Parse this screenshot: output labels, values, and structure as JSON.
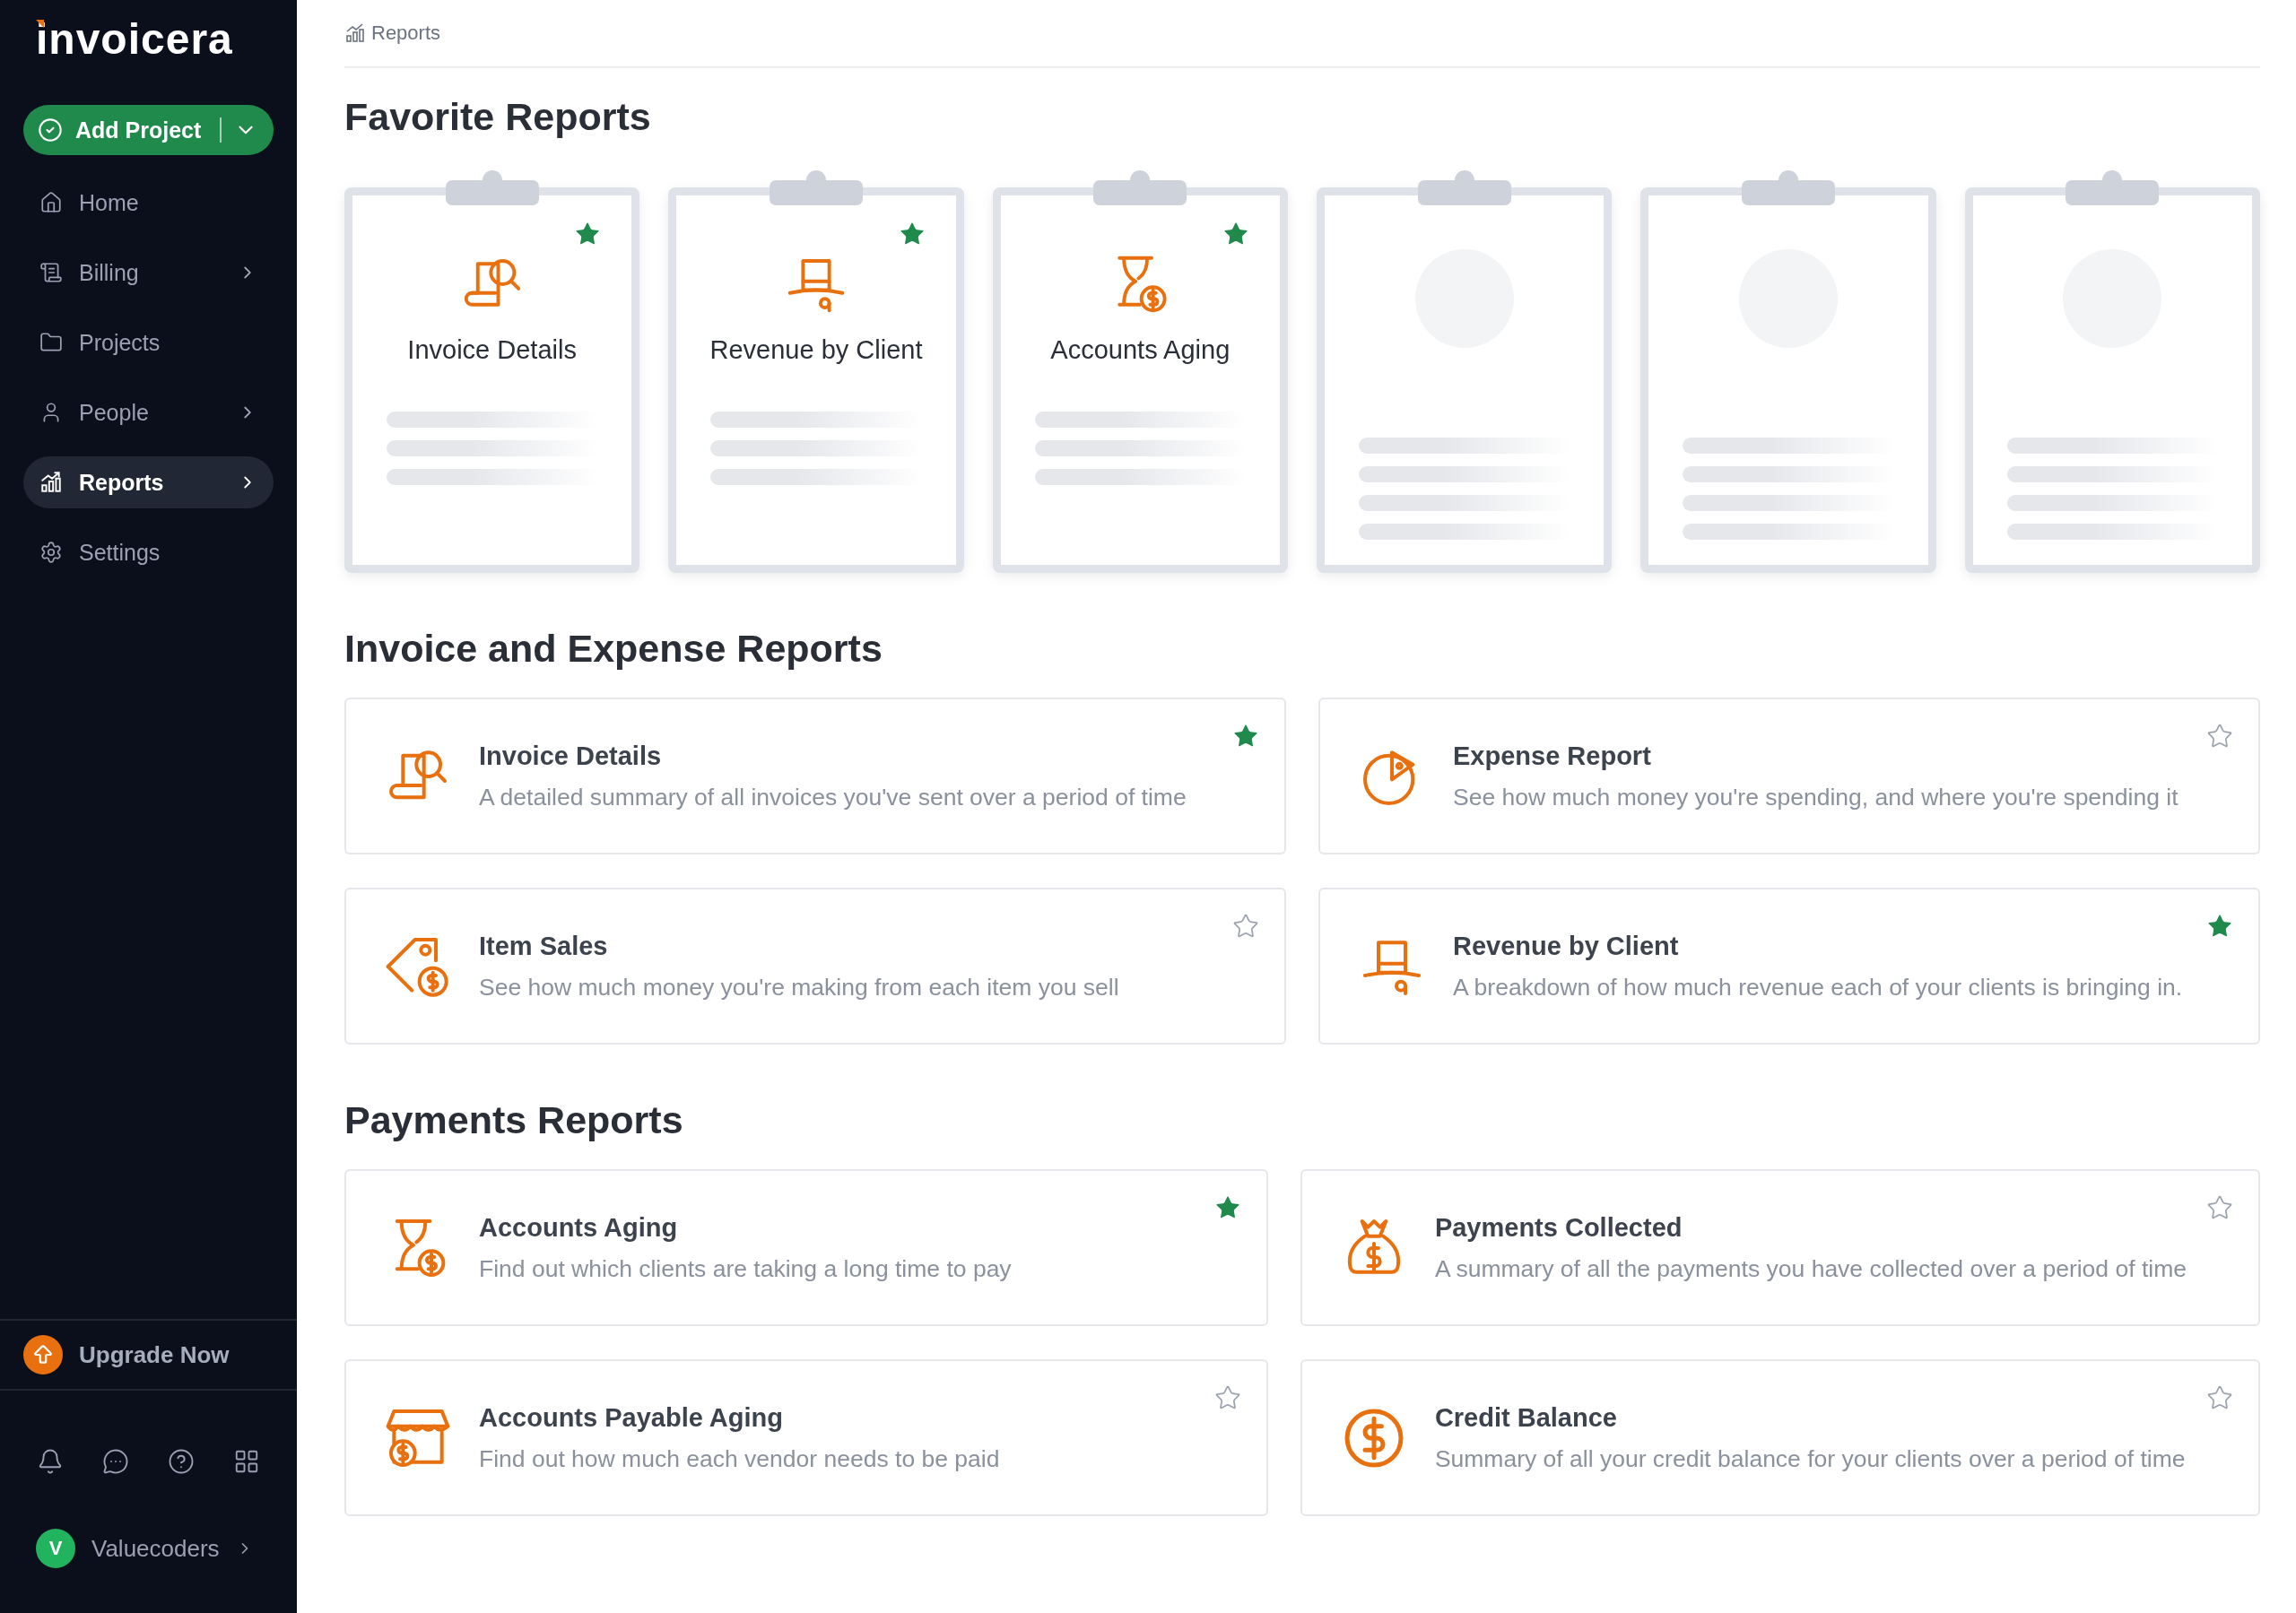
{
  "sidebar": {
    "logo": "invoicera",
    "add_button": {
      "label": "Add Project"
    },
    "nav": [
      {
        "label": "Home",
        "kind": "home",
        "chevron": false,
        "selected": false
      },
      {
        "label": "Billing",
        "kind": "billing",
        "chevron": true,
        "selected": false
      },
      {
        "label": "Projects",
        "kind": "folder",
        "chevron": false,
        "selected": false
      },
      {
        "label": "People",
        "kind": "person",
        "chevron": true,
        "selected": false
      },
      {
        "label": "Reports",
        "kind": "chart",
        "chevron": true,
        "selected": true
      },
      {
        "label": "Settings",
        "kind": "gear",
        "chevron": false,
        "selected": false
      }
    ],
    "upgrade": {
      "label": "Upgrade Now"
    },
    "user": {
      "initial": "V",
      "name": "Valuecoders"
    }
  },
  "breadcrumb": "Reports",
  "favorites": {
    "title": "Favorite Reports",
    "cards": [
      {
        "kind": "invoice",
        "title": "Invoice Details",
        "favorite": true
      },
      {
        "kind": "hat",
        "title": "Revenue by Client",
        "favorite": true
      },
      {
        "kind": "hourglass",
        "title": "Accounts Aging",
        "favorite": true
      },
      {
        "kind": "placeholder"
      },
      {
        "kind": "placeholder"
      },
      {
        "kind": "placeholder"
      }
    ]
  },
  "sections": [
    {
      "title": "Invoice and Expense Reports",
      "reports": [
        {
          "title": "Invoice Details",
          "description": "A detailed summary of all invoices you've sent over a period of time",
          "kind": "invoice",
          "favorite": true
        },
        {
          "title": "Expense Report",
          "description": "See how much money you're spending, and where you're spending it",
          "kind": "pie",
          "favorite": false
        },
        {
          "title": "Item Sales",
          "description": "See how much money you're making from each item you sell",
          "kind": "tag",
          "favorite": false
        },
        {
          "title": "Revenue by Client",
          "description": "A breakdown of how much revenue each of your clients is bringing in.",
          "kind": "hat",
          "favorite": true
        }
      ]
    },
    {
      "title": "Payments Reports",
      "reports": [
        {
          "title": "Accounts Aging",
          "description": "Find out which clients are taking a long time to pay",
          "kind": "hourglass",
          "favorite": true
        },
        {
          "title": "Payments Collected",
          "description": "A summary of all the payments you have collected over a period of time",
          "kind": "bag",
          "favorite": false
        },
        {
          "title": "Accounts Payable Aging",
          "description": "Find out how much each vendor needs to be paid",
          "kind": "store",
          "favorite": false
        },
        {
          "title": "Credit Balance",
          "description": "Summary of all your credit balance for your clients over a period of time",
          "kind": "dollar",
          "favorite": false
        }
      ]
    }
  ]
}
